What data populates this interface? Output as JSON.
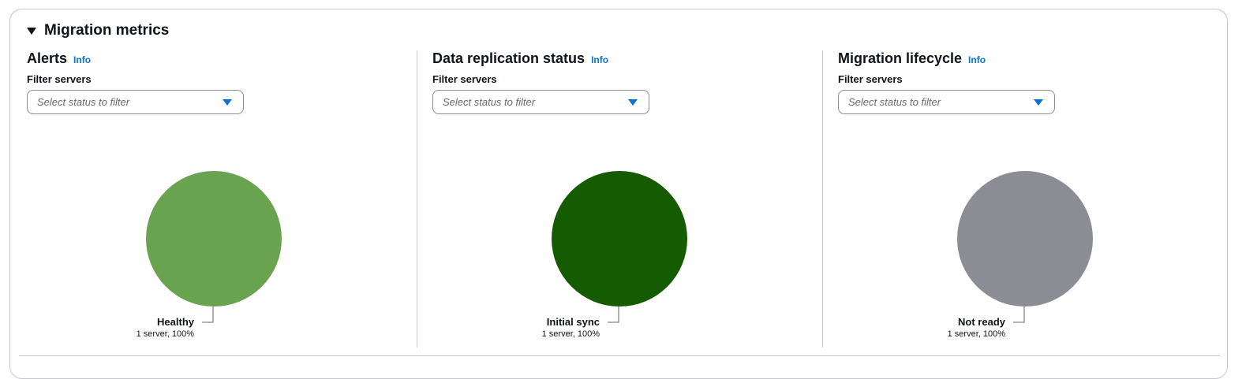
{
  "section": {
    "title": "Migration metrics"
  },
  "panels": [
    {
      "title": "Alerts",
      "info": "Info",
      "filter_label": "Filter servers",
      "filter_placeholder": "Select status to filter",
      "segment": {
        "label": "Healthy",
        "detail": "1 server, 100%",
        "color": "#69a350",
        "percent": 100
      }
    },
    {
      "title": "Data replication status",
      "info": "Info",
      "filter_label": "Filter servers",
      "filter_placeholder": "Select status to filter",
      "segment": {
        "label": "Initial sync",
        "detail": "1 server, 100%",
        "color": "#155b01",
        "percent": 100
      }
    },
    {
      "title": "Migration lifecycle",
      "info": "Info",
      "filter_label": "Filter servers",
      "filter_placeholder": "Select status to filter",
      "segment": {
        "label": "Not ready",
        "detail": "1 server, 100%",
        "color": "#8c8c94",
        "percent": 100
      }
    }
  ],
  "chart_data": [
    {
      "type": "pie",
      "categories": [
        "Healthy"
      ],
      "values": [
        1
      ],
      "title": "Alerts"
    },
    {
      "type": "pie",
      "categories": [
        "Initial sync"
      ],
      "values": [
        1
      ],
      "title": "Data replication status"
    },
    {
      "type": "pie",
      "categories": [
        "Not ready"
      ],
      "values": [
        1
      ],
      "title": "Migration lifecycle"
    }
  ]
}
